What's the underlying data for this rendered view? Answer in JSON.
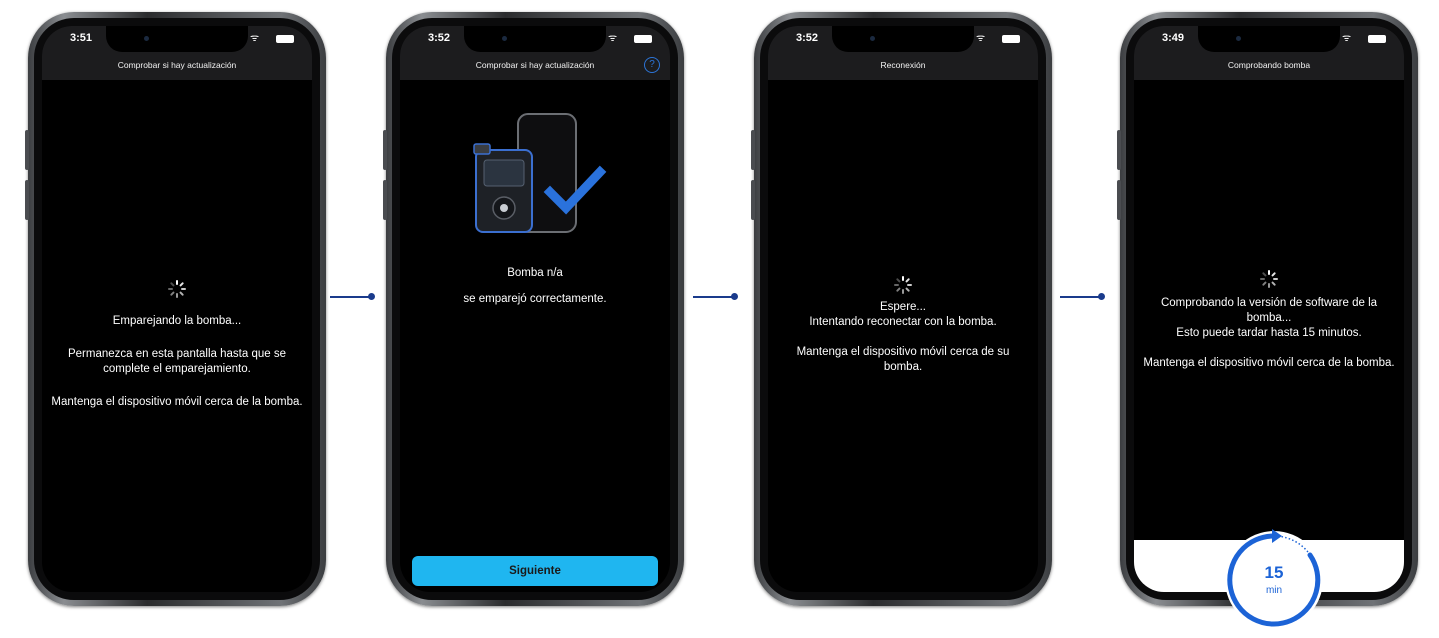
{
  "colors": {
    "accent_button": "#1fb6f0",
    "connector": "#1a3b8c",
    "checkmark": "#2a72dc",
    "timer": "#1c63d6",
    "help_icon": "#2c74d6"
  },
  "screens": [
    {
      "time": "3:51",
      "title": "Comprobar si hay actualización",
      "lines": [
        "Emparejando la bomba...",
        "Permanezca en esta pantalla hasta que se complete el emparejamiento.",
        "Mantenga el dispositivo móvil cerca de la bomba."
      ]
    },
    {
      "time": "3:52",
      "title": "Comprobar si hay actualización",
      "help_icon": "?",
      "lines": [
        "Bomba n/a",
        "se emparejó correctamente."
      ],
      "button": "Siguiente"
    },
    {
      "time": "3:52",
      "title": "Reconexión",
      "lines": [
        "Espere...",
        "Intentando reconectar con la bomba.",
        "Mantenga el dispositivo móvil cerca de su bomba."
      ]
    },
    {
      "time": "3:49",
      "title": "Comprobando bomba",
      "lines": [
        "Comprobando la versión de software de la bomba...",
        "Esto puede tardar hasta 15 minutos.",
        "Mantenga el dispositivo móvil cerca de la bomba."
      ]
    }
  ],
  "timer": {
    "value": "15",
    "unit": "min"
  }
}
